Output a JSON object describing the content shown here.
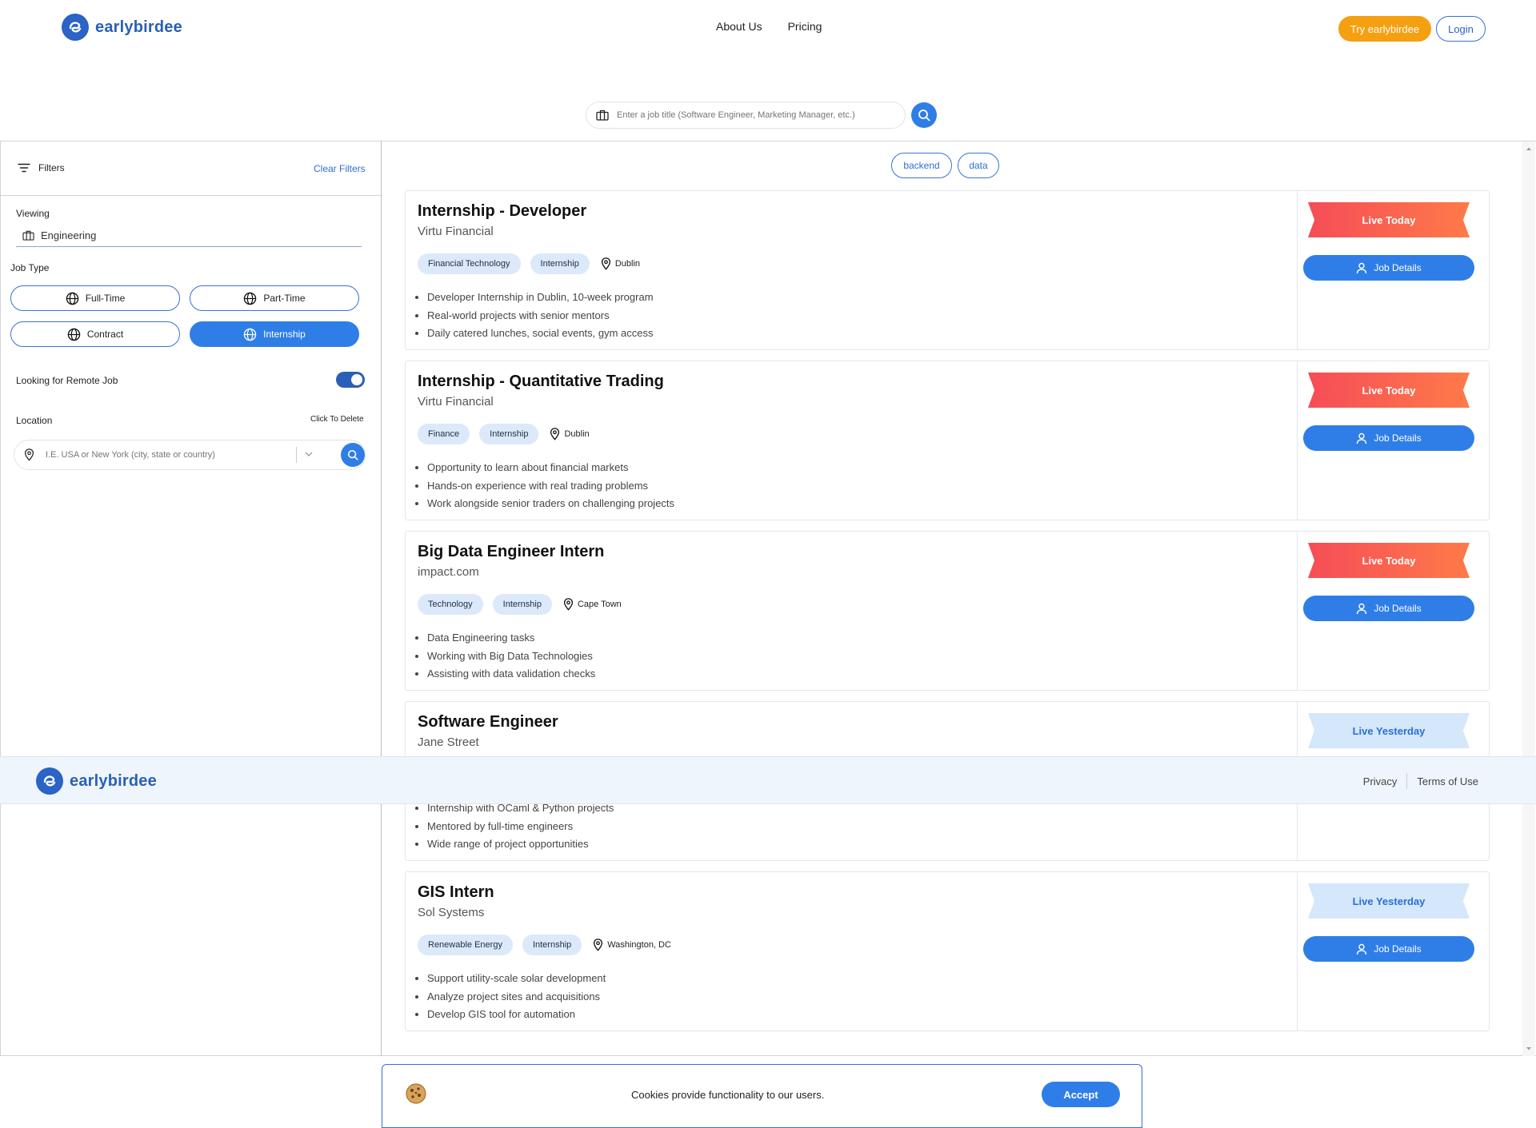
{
  "brand": {
    "name": "earlybirdee"
  },
  "nav": {
    "about": "About Us",
    "pricing": "Pricing",
    "try": "Try earlybirdee",
    "login": "Login"
  },
  "search": {
    "placeholder": "Enter a job title (Software Engineer, Marketing Manager, etc.)"
  },
  "filters": {
    "title": "Filters",
    "clear": "Clear Filters",
    "viewing_label": "Viewing",
    "viewing_value": "Engineering",
    "job_type_label": "Job Type",
    "job_types": [
      "Full-Time",
      "Part-Time",
      "Contract",
      "Internship"
    ],
    "active_job_type": "Internship",
    "remote_label": "Looking for Remote Job",
    "remote_on": true,
    "location_label": "Location",
    "click_to_delete": "Click To Delete",
    "location_placeholder": "I.E. USA or New York (city, state or country)"
  },
  "tags": [
    "backend",
    "data"
  ],
  "jobs": [
    {
      "title": "Internship - Developer",
      "company": "Virtu Financial",
      "industry": "Financial Technology",
      "type": "Internship",
      "location": "Dublin",
      "bullets": [
        "Developer Internship in Dublin, 10-week program",
        "Real-world projects with senior mentors",
        "Daily catered lunches, social events, gym access"
      ],
      "live": "Live Today",
      "details": "Job Details"
    },
    {
      "title": "Internship - Quantitative Trading",
      "company": "Virtu Financial",
      "industry": "Finance",
      "type": "Internship",
      "location": "Dublin",
      "bullets": [
        "Opportunity to learn about financial markets",
        "Hands-on experience with real trading problems",
        "Work alongside senior traders on challenging projects"
      ],
      "live": "Live Today",
      "details": "Job Details"
    },
    {
      "title": "Big Data Engineer Intern",
      "company": "impact.com",
      "industry": "Technology",
      "type": "Internship",
      "location": "Cape Town",
      "bullets": [
        "Data Engineering tasks",
        "Working with Big Data Technologies",
        "Assisting with data validation checks"
      ],
      "live": "Live Today",
      "details": "Job Details"
    },
    {
      "title": "Software Engineer",
      "company": "Jane Street",
      "bullets": [
        "Internship with OCaml & Python projects",
        "Mentored by full-time engineers",
        "Wide range of project opportunities"
      ],
      "live": "Live Yesterday"
    },
    {
      "title": "GIS Intern",
      "company": "Sol Systems",
      "industry": "Renewable Energy",
      "type": "Internship",
      "location": "Washington, DC",
      "bullets": [
        "Support utility-scale solar development",
        "Analyze project sites and acquisitions",
        "Develop GIS tool for automation"
      ],
      "live": "Live Yesterday",
      "details": "Job Details"
    }
  ],
  "footer": {
    "privacy": "Privacy",
    "terms": "Terms of Use"
  },
  "cookie": {
    "text": "Cookies provide functionality to our users.",
    "accept": "Accept"
  },
  "colors": {
    "brand": "#2a5fb8",
    "accent": "#2f7ee8",
    "try": "#f5a011",
    "live_today": "#f54d57",
    "live_yesterday": "#d4e7fb"
  }
}
